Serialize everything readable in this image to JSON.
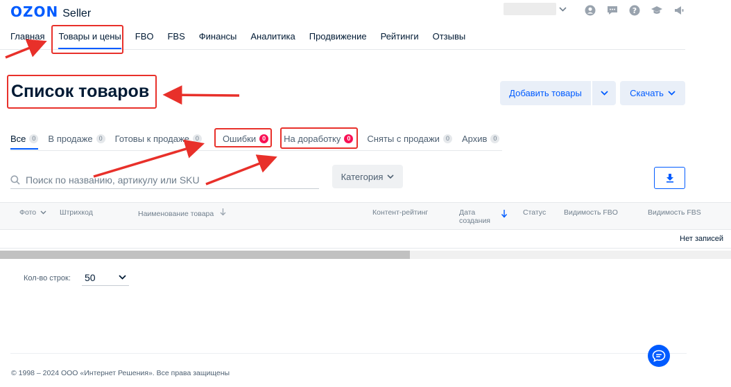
{
  "header": {
    "logo_brand": "OZON",
    "logo_product": "Seller",
    "icons": [
      "user-icon",
      "chat-icon",
      "help-icon",
      "education-icon",
      "announcement-icon"
    ]
  },
  "nav": {
    "items": [
      "Главная",
      "Товары и цены",
      "FBO",
      "FBS",
      "Финансы",
      "Аналитика",
      "Продвижение",
      "Рейтинги",
      "Отзывы"
    ],
    "active": "Товары и цены"
  },
  "page": {
    "title": "Список товаров",
    "add_button": "Добавить товары",
    "download_button": "Скачать"
  },
  "tabs": [
    {
      "label": "Все",
      "count": "0",
      "active": true,
      "alert": false
    },
    {
      "label": "В продаже",
      "count": "0",
      "active": false,
      "alert": false
    },
    {
      "label": "Готовы к продаже",
      "count": "0",
      "active": false,
      "alert": false
    },
    {
      "label": "Ошибки",
      "count": "0",
      "active": false,
      "alert": true
    },
    {
      "label": "На доработку",
      "count": "0",
      "active": false,
      "alert": true
    },
    {
      "label": "Сняты с продажи",
      "count": "0",
      "active": false,
      "alert": false
    },
    {
      "label": "Архив",
      "count": "0",
      "active": false,
      "alert": false
    }
  ],
  "search": {
    "placeholder": "Поиск по названию, артикулу или SKU",
    "value": ""
  },
  "filters": {
    "category_label": "Категория"
  },
  "table": {
    "columns": {
      "photo": "Фото",
      "barcode": "Штрихкод",
      "name": "Наименование товара",
      "content_rating": "Контент-рейтинг",
      "created_line1": "Дата",
      "created_line2": "создания",
      "status": "Статус",
      "visibility_fbo": "Видимость FBO",
      "visibility_fbs": "Видимость FBS"
    },
    "empty_text": "Нет записей"
  },
  "pagination": {
    "rows_label": "Кол-во строк:",
    "rows_value": "50"
  },
  "footer": {
    "copyright": "© 1998 – 2024 ООО «Интернет Решения». Все права защищены"
  },
  "colors": {
    "brand": "#005bff",
    "text": "#001a34",
    "alert": "#f91155",
    "annotation": "#e8302a"
  }
}
